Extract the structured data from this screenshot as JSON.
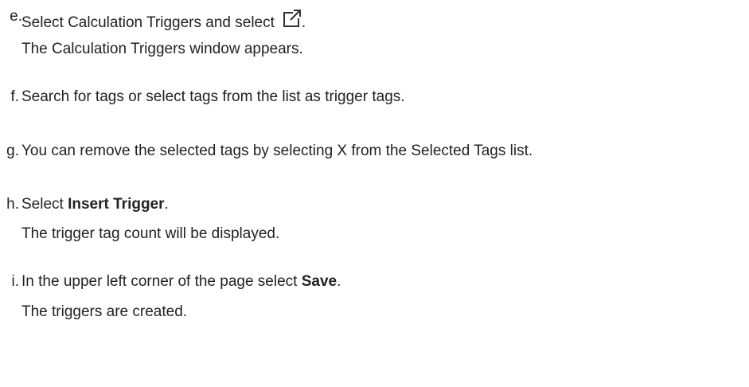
{
  "steps": [
    {
      "marker": "e.",
      "text_before": "Select Calculation Triggers and select",
      "icon": "open-in-new-window-icon",
      "text_after": ".",
      "result": "The Calculation Triggers window appears."
    },
    {
      "marker": "f.",
      "text": "Search for tags or select tags from the list as trigger tags."
    },
    {
      "marker": "g.",
      "text": "You can remove the selected tags by selecting X from the Selected Tags list."
    },
    {
      "marker": "h.",
      "text_before": "Select ",
      "bold": "Insert Trigger",
      "text_after": ".",
      "result": "The trigger tag count will be displayed."
    },
    {
      "marker": "i.",
      "text_before": "In the upper left corner of the page select ",
      "bold": "Save",
      "text_after": ".",
      "result": "The triggers are created."
    }
  ]
}
